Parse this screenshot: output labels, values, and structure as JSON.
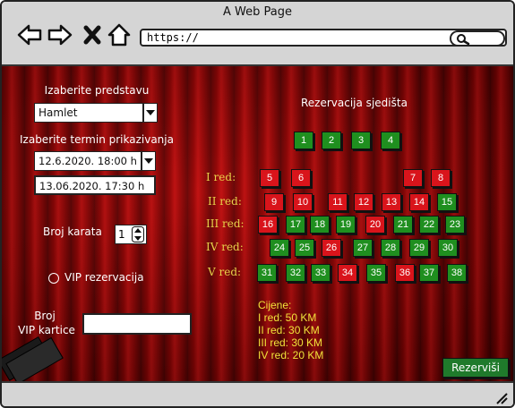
{
  "window": {
    "title": "A Web Page"
  },
  "browser": {
    "url": "https://"
  },
  "form": {
    "show_label": "Izaberite predstavu",
    "show_value": "Hamlet",
    "time_label": "Izaberite termin prikazivanja",
    "time_value": "12.6.2020. 18:00 h",
    "time_option2": "13.06.2020. 17:30 h",
    "tickets_label": "Broj karata",
    "tickets_value": "1",
    "vip_label": "VIP rezervacija",
    "vip_card_label_line1": "Broj",
    "vip_card_label_line2": "VIP kartice",
    "vip_card_value": ""
  },
  "seating": {
    "title": "Rezervacija sjedišta",
    "selected": [
      "1",
      "2",
      "3",
      "4"
    ],
    "rows": [
      {
        "label": "I red:",
        "seats": [
          {
            "n": "5",
            "status": "taken"
          },
          {
            "n": "6",
            "status": "taken"
          },
          {
            "n": "7",
            "status": "taken"
          },
          {
            "n": "8",
            "status": "taken"
          }
        ]
      },
      {
        "label": "II red:",
        "seats": [
          {
            "n": "9",
            "status": "taken"
          },
          {
            "n": "10",
            "status": "taken"
          },
          {
            "n": "11",
            "status": "taken"
          },
          {
            "n": "12",
            "status": "taken"
          },
          {
            "n": "13",
            "status": "taken"
          },
          {
            "n": "14",
            "status": "taken"
          },
          {
            "n": "15",
            "status": "free"
          }
        ]
      },
      {
        "label": "III red:",
        "seats": [
          {
            "n": "16",
            "status": "taken"
          },
          {
            "n": "17",
            "status": "free"
          },
          {
            "n": "18",
            "status": "free"
          },
          {
            "n": "19",
            "status": "free"
          },
          {
            "n": "20",
            "status": "taken"
          },
          {
            "n": "21",
            "status": "free"
          },
          {
            "n": "22",
            "status": "free"
          },
          {
            "n": "23",
            "status": "free"
          }
        ]
      },
      {
        "label": "IV red:",
        "seats": [
          {
            "n": "24",
            "status": "free"
          },
          {
            "n": "25",
            "status": "free"
          },
          {
            "n": "26",
            "status": "taken"
          },
          {
            "n": "27",
            "status": "free"
          },
          {
            "n": "28",
            "status": "free"
          },
          {
            "n": "29",
            "status": "free"
          },
          {
            "n": "30",
            "status": "free"
          }
        ]
      },
      {
        "label": "V red:",
        "seats": [
          {
            "n": "31",
            "status": "free"
          },
          {
            "n": "32",
            "status": "free"
          },
          {
            "n": "33",
            "status": "free"
          },
          {
            "n": "34",
            "status": "taken"
          },
          {
            "n": "35",
            "status": "free"
          },
          {
            "n": "36",
            "status": "taken"
          },
          {
            "n": "37",
            "status": "free"
          },
          {
            "n": "38",
            "status": "free"
          }
        ]
      }
    ]
  },
  "prices": {
    "title": "Cijene:",
    "lines": [
      "I red: 50 KM",
      "II red: 30  KM",
      "III red: 30 KM",
      "IV red: 20 KM"
    ]
  },
  "actions": {
    "reserve_label": "Rezerviši"
  },
  "colors": {
    "free": "#1f8f1f",
    "taken": "#d9141b",
    "price_text": "#f1e23a",
    "row_label": "#e7d24a"
  }
}
